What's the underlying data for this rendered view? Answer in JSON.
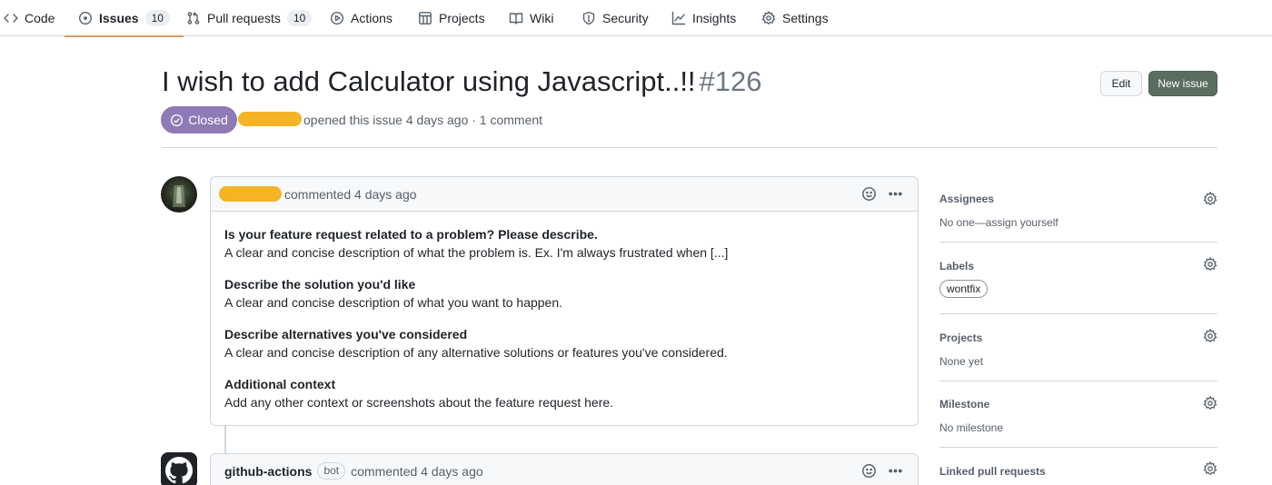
{
  "repo_nav": {
    "tabs": [
      {
        "label": "Code",
        "icon": "code-icon"
      },
      {
        "label": "Issues",
        "icon": "issue-opened-icon",
        "count": "10",
        "active": true
      },
      {
        "label": "Pull requests",
        "icon": "git-pull-request-icon",
        "count": "10"
      },
      {
        "label": "Actions",
        "icon": "play-icon"
      },
      {
        "label": "Projects",
        "icon": "table-icon"
      },
      {
        "label": "Wiki",
        "icon": "book-icon"
      },
      {
        "label": "Security",
        "icon": "shield-icon"
      },
      {
        "label": "Insights",
        "icon": "graph-icon"
      },
      {
        "label": "Settings",
        "icon": "gear-icon"
      }
    ]
  },
  "issue": {
    "title": "I wish to add Calculator using Javascript..!!",
    "number": "#126",
    "state": "Closed",
    "meta": "opened this issue 4 days ago · 1 comment",
    "edit_label": "Edit",
    "new_issue_label": "New issue"
  },
  "comments": [
    {
      "author": "",
      "action": "commented 4 days ago",
      "sections": [
        {
          "title": "Is your feature request related to a problem? Please describe.",
          "text": "A clear and concise description of what the problem is. Ex. I'm always frustrated when [...]"
        },
        {
          "title": "Describe the solution you'd like",
          "text": "A clear and concise description of what you want to happen."
        },
        {
          "title": "Describe alternatives you've considered",
          "text": "A clear and concise description of any alternative solutions or features you've considered."
        },
        {
          "title": "Additional context",
          "text": "Add any other context or screenshots about the feature request here."
        }
      ]
    },
    {
      "author": "github-actions",
      "badge": "bot",
      "action": "commented 4 days ago"
    }
  ],
  "sidebar": {
    "assignees": {
      "heading": "Assignees",
      "value": "No one—assign yourself"
    },
    "labels": {
      "heading": "Labels",
      "items": [
        "wontfix"
      ]
    },
    "projects": {
      "heading": "Projects",
      "value": "None yet"
    },
    "milestone": {
      "heading": "Milestone",
      "value": "No milestone"
    },
    "linked_prs": {
      "heading": "Linked pull requests"
    }
  },
  "colors": {
    "closed_badge": "#8e7ab5",
    "new_issue_button": "#5a6e60",
    "active_tab_underline": "#d59b6b",
    "redaction": "#f5b326"
  }
}
